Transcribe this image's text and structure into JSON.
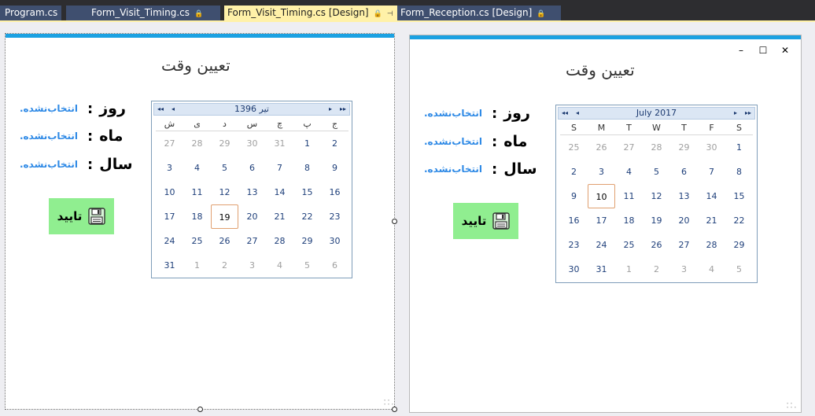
{
  "tabs": [
    {
      "label": "Program.cs",
      "pin": "🔒"
    },
    {
      "label": "Form_Visit_Timing.cs",
      "pin": "🔒"
    },
    {
      "label": "Form_Visit_Timing.cs [Design]",
      "pin": "🔒",
      "extra": "⊣",
      "close": "✕",
      "active": true
    },
    {
      "label": "Form_Reception.cs [Design]",
      "pin": "🔒"
    }
  ],
  "left_form": {
    "title": "تعیین وقت",
    "fields": [
      {
        "label": "روز",
        "colon": ":",
        "value": "انتخاب‌نشده."
      },
      {
        "label": "ماه",
        "colon": ":",
        "value": "انتخاب‌نشده."
      },
      {
        "label": "سال",
        "colon": ":",
        "value": "انتخاب‌نشده."
      }
    ],
    "confirm_label": "تایید",
    "calendar": {
      "nav_prev_year": "◂◂",
      "nav_prev": "◂",
      "nav_next": "▸",
      "nav_next_year": "▸▸",
      "title": "تیر 1396",
      "weekdays": [
        "ش",
        "ی",
        "د",
        "س",
        "چ",
        "پ",
        "ج"
      ],
      "weeks": [
        [
          "27",
          "28",
          "29",
          "30",
          "31",
          "1",
          "2"
        ],
        [
          "3",
          "4",
          "5",
          "6",
          "7",
          "8",
          "9"
        ],
        [
          "10",
          "11",
          "12",
          "13",
          "14",
          "15",
          "16"
        ],
        [
          "17",
          "18",
          "19",
          "20",
          "21",
          "22",
          "23"
        ],
        [
          "24",
          "25",
          "26",
          "27",
          "28",
          "29",
          "30"
        ],
        [
          "31",
          "1",
          "2",
          "3",
          "4",
          "5",
          "6"
        ]
      ],
      "today": "19"
    }
  },
  "right_form": {
    "title": "تعیین وقت",
    "window_controls": {
      "minimize": "–",
      "maximize": "☐",
      "close": "✕"
    },
    "fields": [
      {
        "label": "روز",
        "colon": ":",
        "value": "انتخاب‌نشده."
      },
      {
        "label": "ماه",
        "colon": ":",
        "value": "انتخاب‌نشده."
      },
      {
        "label": "سال",
        "colon": ":",
        "value": "انتخاب‌نشده."
      }
    ],
    "confirm_label": "تایید",
    "calendar": {
      "nav_prev_year": "◂◂",
      "nav_prev": "◂",
      "nav_next": "▸",
      "nav_next_year": "▸▸",
      "title": "July 2017",
      "weekdays": [
        "S",
        "M",
        "T",
        "W",
        "T",
        "F",
        "S"
      ],
      "weeks": [
        [
          "25",
          "26",
          "27",
          "28",
          "29",
          "30",
          "1"
        ],
        [
          "2",
          "3",
          "4",
          "5",
          "6",
          "7",
          "8"
        ],
        [
          "9",
          "10",
          "11",
          "12",
          "13",
          "14",
          "15"
        ],
        [
          "16",
          "17",
          "18",
          "19",
          "20",
          "21",
          "22"
        ],
        [
          "23",
          "24",
          "25",
          "26",
          "27",
          "28",
          "29"
        ],
        [
          "30",
          "31",
          "1",
          "2",
          "3",
          "4",
          "5"
        ]
      ],
      "today": "10"
    }
  },
  "colors": {
    "accent_bar": "#1ba1e2",
    "value_text": "#2f8ae6",
    "confirm_button": "#90ee90",
    "active_tab": "#fff1a8",
    "inactive_tab": "#3f4f6f",
    "tabstrip_bg": "#2d2d30"
  },
  "icons": {
    "save": "floppy-disk-icon",
    "pin": "pin-icon",
    "close": "close-icon"
  }
}
